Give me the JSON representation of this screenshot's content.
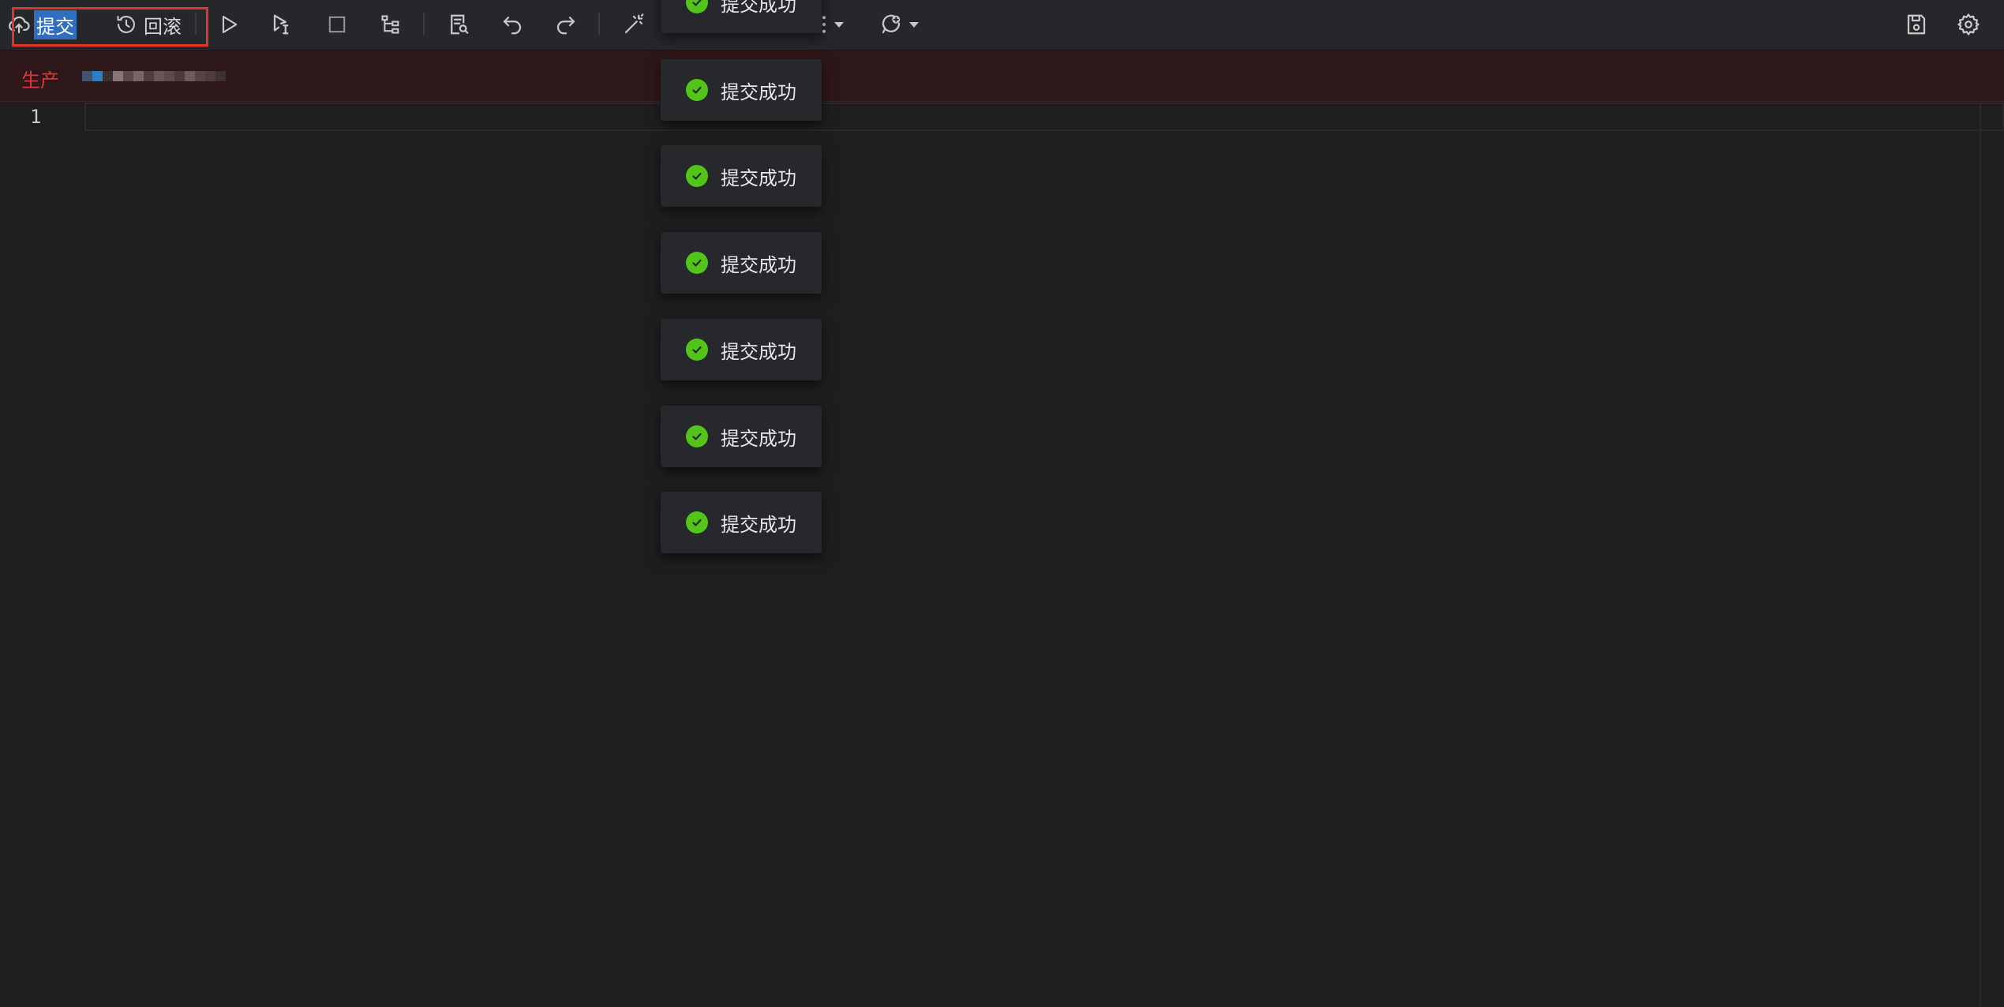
{
  "toolbar": {
    "submit_label": "提交",
    "rollback_label": "回滚"
  },
  "environment": {
    "label": "生产"
  },
  "editor": {
    "line_numbers": [
      "1"
    ]
  },
  "toasts": [
    {
      "message": "提交成功"
    },
    {
      "message": "提交成功"
    },
    {
      "message": "提交成功"
    },
    {
      "message": "提交成功"
    },
    {
      "message": "提交成功"
    },
    {
      "message": "提交成功"
    },
    {
      "message": "提交成功"
    }
  ],
  "colors": {
    "toolbar_bg": "#25272b",
    "editor_bg": "#1e1e1e",
    "env_bar_bg": "#2d1719",
    "env_label": "#e0363a",
    "success_icon": "#52c41a",
    "selection": "#2f6fbd",
    "highlight_box": "#e5312c"
  },
  "icons": [
    "cloud-upload-icon",
    "history-icon",
    "play-icon",
    "run-selection-icon",
    "stop-icon",
    "tree-icon",
    "explain-icon",
    "undo-icon",
    "redo-icon",
    "magic-wand-icon",
    "more-icon",
    "comment-add-icon",
    "save-icon",
    "gear-icon",
    "check-circle-icon"
  ]
}
